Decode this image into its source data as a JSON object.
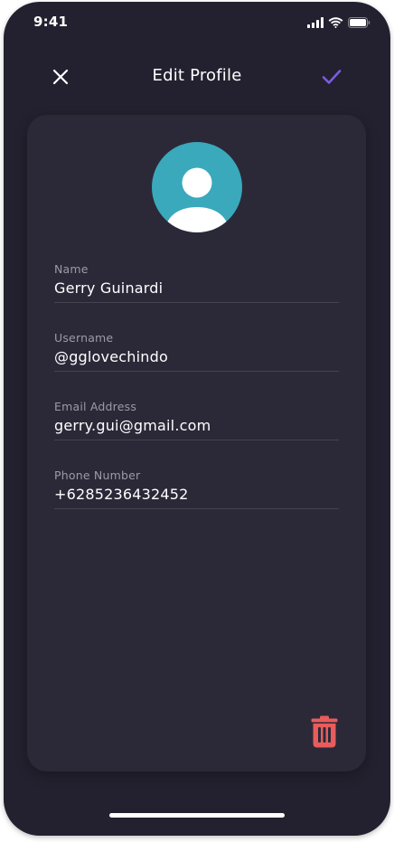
{
  "status_bar": {
    "time": "9:41",
    "icons": [
      "signal-icon",
      "wifi-icon",
      "battery-icon"
    ]
  },
  "nav": {
    "title": "Edit Profile",
    "close_icon": "close-icon",
    "save_icon": "check-icon"
  },
  "profile": {
    "avatar_icon": "user-avatar-icon",
    "fields": [
      {
        "label": "Name",
        "value": "Gerry Guinardi"
      },
      {
        "label": "Username",
        "value": "@gglovechindo"
      },
      {
        "label": "Email Address",
        "value": "gerry.gui@gmail.com"
      },
      {
        "label": "Phone Number",
        "value": "+6285236432452"
      }
    ]
  },
  "actions": {
    "delete_icon": "trash-icon"
  },
  "colors": {
    "background": "#23212f",
    "card": "#2b2938",
    "accent": "#7b5ce0",
    "avatar": "#3aa9bc",
    "danger": "#e85c5c",
    "label": "#9c9aa6",
    "text": "#ffffff"
  }
}
